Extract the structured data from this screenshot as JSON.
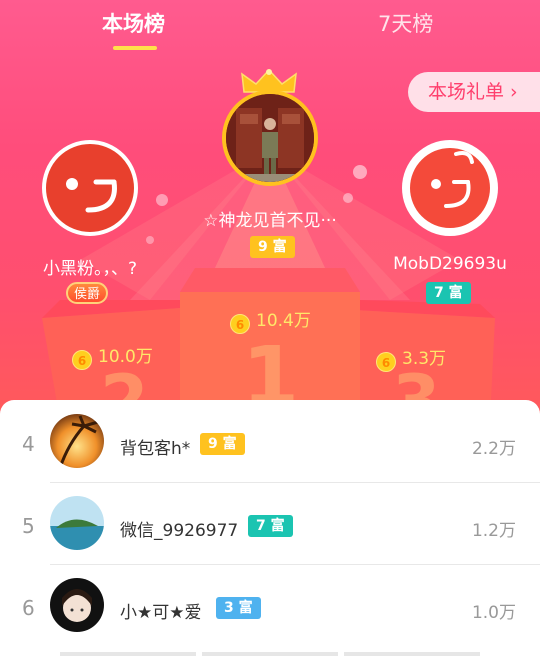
{
  "tabs": {
    "current": "本场榜",
    "seven_day": "7天榜"
  },
  "gift_list_button": {
    "label": "本场礼单",
    "chevron": "›"
  },
  "podium": {
    "first": {
      "name": "☆神龙见首不见···",
      "wealth": "9 富",
      "amount": "10.4万",
      "rank_digit": "1"
    },
    "second": {
      "name": "小黑粉。，、?",
      "badge": "侯爵",
      "amount": "10.0万",
      "rank_digit": "2"
    },
    "third": {
      "name": "MobD29693u",
      "wealth": "7 富",
      "amount": "3.3万",
      "rank_digit": "3"
    }
  },
  "coin_symbol": "6",
  "list": [
    {
      "rank": "4",
      "name": "背包客h*",
      "wealth": "9 富",
      "amount": "2.2万",
      "badge_color": "#ffc21f"
    },
    {
      "rank": "5",
      "name": "微信_9926977",
      "wealth": "7 富",
      "amount": "1.2万",
      "badge_color": "#1bc4b1"
    },
    {
      "rank": "6",
      "name": "小★可★爱",
      "wealth": "3 富",
      "amount": "1.0万",
      "badge_color": "#4fb2ef"
    }
  ],
  "colors": {
    "header_pink": "#ff4d7b",
    "accent_yellow": "#ffe14a"
  }
}
